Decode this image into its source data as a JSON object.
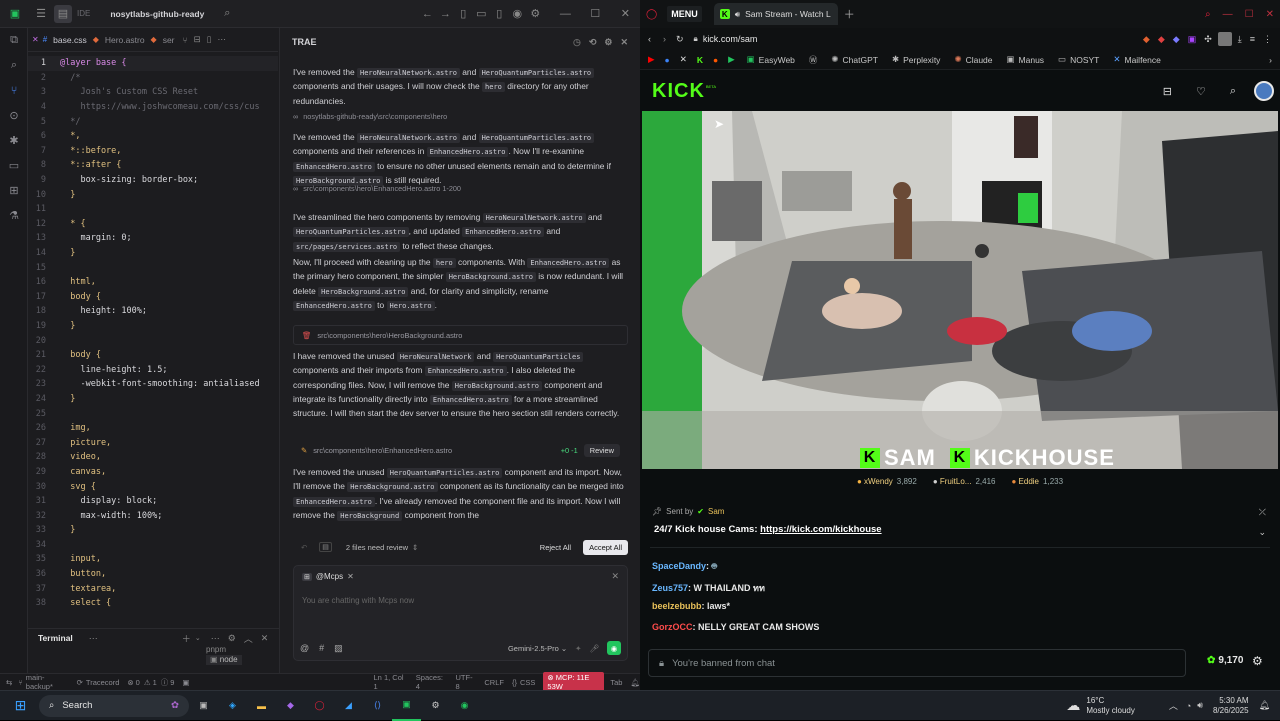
{
  "ide": {
    "ide_label": "IDE",
    "project": "nosytlabs-github-ready",
    "tabs": [
      "base.css",
      "Hero.astro",
      "ser"
    ],
    "code_lines": [
      {
        "n": "1",
        "t": "@layer base {"
      },
      {
        "n": "2",
        "t": "  /*"
      },
      {
        "n": "3",
        "t": "    Josh's Custom CSS Reset"
      },
      {
        "n": "4",
        "t": "    https://www.joshwcomeau.com/css/cus"
      },
      {
        "n": "5",
        "t": "  */"
      },
      {
        "n": "6",
        "t": "  *,"
      },
      {
        "n": "7",
        "t": "  *::before,"
      },
      {
        "n": "8",
        "t": "  *::after {"
      },
      {
        "n": "9",
        "t": "    box-sizing: border-box;"
      },
      {
        "n": "10",
        "t": "  }"
      },
      {
        "n": "11",
        "t": ""
      },
      {
        "n": "12",
        "t": "  * {"
      },
      {
        "n": "13",
        "t": "    margin: 0;"
      },
      {
        "n": "14",
        "t": "  }"
      },
      {
        "n": "15",
        "t": ""
      },
      {
        "n": "16",
        "t": "  html,"
      },
      {
        "n": "17",
        "t": "  body {"
      },
      {
        "n": "18",
        "t": "    height: 100%;"
      },
      {
        "n": "19",
        "t": "  }"
      },
      {
        "n": "20",
        "t": ""
      },
      {
        "n": "21",
        "t": "  body {"
      },
      {
        "n": "22",
        "t": "    line-height: 1.5;"
      },
      {
        "n": "23",
        "t": "    -webkit-font-smoothing: antialiased"
      },
      {
        "n": "24",
        "t": "  }"
      },
      {
        "n": "25",
        "t": ""
      },
      {
        "n": "26",
        "t": "  img,"
      },
      {
        "n": "27",
        "t": "  picture,"
      },
      {
        "n": "28",
        "t": "  video,"
      },
      {
        "n": "29",
        "t": "  canvas,"
      },
      {
        "n": "30",
        "t": "  svg {"
      },
      {
        "n": "31",
        "t": "    display: block;"
      },
      {
        "n": "32",
        "t": "    max-width: 100%;"
      },
      {
        "n": "33",
        "t": "  }"
      },
      {
        "n": "34",
        "t": ""
      },
      {
        "n": "35",
        "t": "  input,"
      },
      {
        "n": "36",
        "t": "  button,"
      },
      {
        "n": "37",
        "t": "  textarea,"
      },
      {
        "n": "38",
        "t": "  select {"
      }
    ],
    "terminal_label": "Terminal",
    "terminal_items": [
      "pnpm",
      "node"
    ],
    "statusbar": {
      "branch": "main-backup*",
      "traecord": "Tracecord",
      "errors": "0",
      "warnings": "1",
      "info": "9",
      "position": "Ln 1, Col 1",
      "spaces": "Spaces: 4",
      "encoding": "UTF-8",
      "eol": "CRLF",
      "lang": "CSS",
      "mcp": "MCP: 11E 53W",
      "tab": "Tab"
    }
  },
  "trae": {
    "title": "TRAE",
    "blocks": [
      {
        "type": "msg",
        "parts": [
          [
            "t",
            "I've removed the "
          ],
          [
            "c",
            "HeroNeuralNetwork.astro"
          ],
          [
            "t",
            " and "
          ],
          [
            "c",
            "HeroQuantumParticles.astro"
          ],
          [
            "t",
            " components and their usages. I will now check the "
          ],
          [
            "c",
            "hero"
          ],
          [
            "t",
            " directory for any other redundancies."
          ]
        ]
      },
      {
        "type": "ref",
        "text": "nosytlabs-github-ready\\src\\components\\hero"
      },
      {
        "type": "msg",
        "parts": [
          [
            "t",
            "I've removed the "
          ],
          [
            "c",
            "HeroNeuralNetwork.astro"
          ],
          [
            "t",
            " and "
          ],
          [
            "c",
            "HeroQuantumParticles.astro"
          ],
          [
            "t",
            " components and their references in "
          ],
          [
            "c",
            "EnhancedHero.astro"
          ],
          [
            "t",
            ". Now I'll re-examine "
          ],
          [
            "c",
            "EnhancedHero.astro"
          ],
          [
            "t",
            " to ensure no other unused elements remain and to determine if "
          ],
          [
            "c",
            "HeroBackground.astro"
          ],
          [
            "t",
            " is still required."
          ]
        ]
      },
      {
        "type": "ref",
        "text": "src\\components\\hero\\EnhancedHero.astro 1-200"
      },
      {
        "type": "msg",
        "parts": [
          [
            "t",
            "I've streamlined the hero components by removing "
          ],
          [
            "c",
            "HeroNeuralNetwork.astro"
          ],
          [
            "t",
            " and "
          ],
          [
            "c",
            "HeroQuantumParticles.astro"
          ],
          [
            "t",
            ", and updated "
          ],
          [
            "c",
            "EnhancedHero.astro"
          ],
          [
            "t",
            " and "
          ],
          [
            "c",
            "src/pages/services.astro"
          ],
          [
            "t",
            " to reflect these changes."
          ]
        ]
      },
      {
        "type": "msg",
        "parts": [
          [
            "t",
            "Now, I'll proceed with cleaning up the "
          ],
          [
            "c",
            "hero"
          ],
          [
            "t",
            " components. With "
          ],
          [
            "c",
            "EnhancedHero.astro"
          ],
          [
            "t",
            " as the primary hero component, the simpler "
          ],
          [
            "c",
            "HeroBackground.astro"
          ],
          [
            "t",
            " is now redundant. I will delete "
          ],
          [
            "c",
            "HeroBackground.astro"
          ],
          [
            "t",
            " and, for clarity and simplicity, rename "
          ],
          [
            "c",
            "EnhancedHero.astro"
          ],
          [
            "t",
            " to "
          ],
          [
            "c",
            "Hero.astro"
          ],
          [
            "t",
            "."
          ]
        ]
      },
      {
        "type": "file",
        "text": "src\\components\\hero\\HeroBackground.astro"
      },
      {
        "type": "msg",
        "parts": [
          [
            "t",
            "I have removed the unused "
          ],
          [
            "c",
            "HeroNeuralNetwork"
          ],
          [
            "t",
            " and "
          ],
          [
            "c",
            "HeroQuantumParticles"
          ],
          [
            "t",
            " components and their imports from "
          ],
          [
            "c",
            "EnhancedHero.astro"
          ],
          [
            "t",
            ". I also deleted the corresponding files. Now, I will remove the "
          ],
          [
            "c",
            "HeroBackground.astro"
          ],
          [
            "t",
            " component and integrate its functionality directly into "
          ],
          [
            "c",
            "EnhancedHero.astro"
          ],
          [
            "t",
            " for a more streamlined structure. I will then start the dev server to ensure the hero section still renders correctly."
          ]
        ]
      },
      {
        "type": "file2",
        "text": "src\\components\\hero\\EnhancedHero.astro",
        "diff": "+0 -1",
        "action": "Review"
      },
      {
        "type": "msg",
        "parts": [
          [
            "t",
            "I've removed the unused "
          ],
          [
            "c",
            "HeroQuantumParticles.astro"
          ],
          [
            "t",
            " component and its import. Now, I'll remove the "
          ],
          [
            "c",
            "HeroBackground.astro"
          ],
          [
            "t",
            " component as its functionality can be merged into "
          ],
          [
            "c",
            "EnhancedHero.astro"
          ],
          [
            "t",
            ". I've already removed the component file and its import. Now I will remove the "
          ],
          [
            "c",
            "HeroBackground"
          ],
          [
            "t",
            " component from the"
          ]
        ]
      }
    ],
    "review": {
      "count": "2 files need review",
      "reject": "Reject All",
      "accept": "Accept All"
    },
    "chat": {
      "mention": "@Mcps",
      "placeholder": "You are chatting with Mcps now",
      "model": "Gemini-2.5-Pro"
    }
  },
  "browser": {
    "menu": "MENU",
    "tab_title": "Sam Stream - Watch L",
    "url": "kick.com/sam",
    "bookmarks": [
      "EasyWeb",
      "ChatGPT",
      "Perplexity",
      "Claude",
      "Manus",
      "NOSYT",
      "Mailfence"
    ],
    "logo": "KICK",
    "beta": "BETA",
    "overlay_name": "SAM",
    "overlay_house": "KICKHOUSE",
    "viewers": [
      {
        "name": "xWendy",
        "count": "3,892"
      },
      {
        "name": "FruitLo...",
        "count": "2,416"
      },
      {
        "name": "Eddie",
        "count": "1,233"
      }
    ],
    "pinned": {
      "sent_by": "Sent by",
      "sender": "Sam",
      "text": "24/7 Kick house Cams: ",
      "link": "https://kick.com/kickhouse"
    },
    "chat": [
      {
        "user": "SpaceDandy",
        "color": "#69b7ff",
        "text": ""
      },
      {
        "user": "Zeus757",
        "color": "#69b7ff",
        "text": "W THAILAND ทท"
      },
      {
        "user": "beelzebubb",
        "color": "#e9c15a",
        "text": "laws*"
      },
      {
        "user": "GorzOCC",
        "color": "#ff4c4c",
        "text": "NELLY GREAT CAM SHOWS"
      }
    ],
    "banned": "You're banned from chat",
    "points": "9,170"
  },
  "taskbar": {
    "search": "Search",
    "temp": "16°C",
    "weather": "Mostly cloudy",
    "time": "5:30 AM",
    "date": "8/26/2025"
  },
  "colors": {
    "kick_green": "#53fc18",
    "trae_green": "#22c55e",
    "accent_blue": "#4b8bff"
  }
}
